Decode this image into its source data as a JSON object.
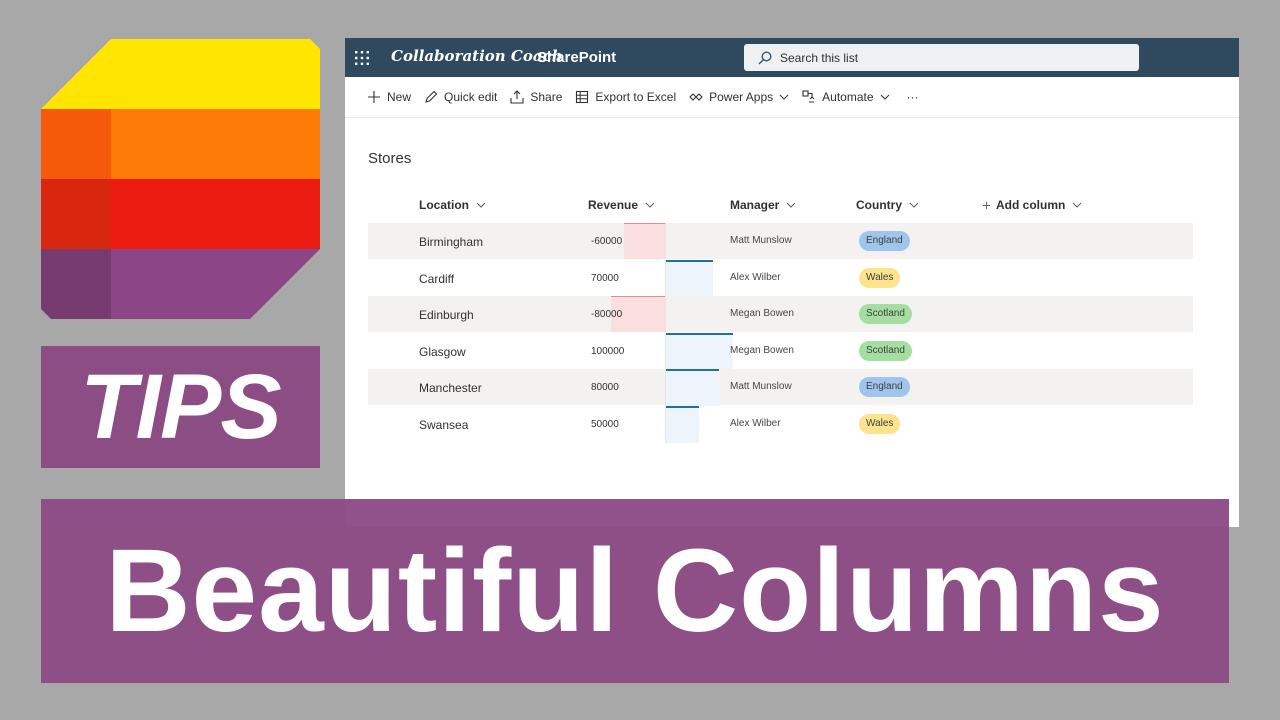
{
  "tips": {
    "label": "TIPS"
  },
  "banner": {
    "title": "Beautiful Columns"
  },
  "sharepoint": {
    "brand": "Collaboration Coach",
    "app_name": "SharePoint",
    "search_placeholder": "Search this list"
  },
  "toolbar": {
    "new": "New",
    "quick_edit": "Quick edit",
    "share": "Share",
    "export": "Export to Excel",
    "power_apps": "Power Apps",
    "automate": "Automate",
    "more": "···"
  },
  "list": {
    "title": "Stores",
    "columns": {
      "location": "Location",
      "revenue": "Revenue",
      "manager": "Manager",
      "country": "Country",
      "add": "Add column"
    },
    "rows": [
      {
        "location": "Birmingham",
        "revenue": "-60000",
        "revenue_value": -60000,
        "manager": "Matt Munslow",
        "country": "England"
      },
      {
        "location": "Cardiff",
        "revenue": "70000",
        "revenue_value": 70000,
        "manager": "Alex Wilber",
        "country": "Wales"
      },
      {
        "location": "Edinburgh",
        "revenue": "-80000",
        "revenue_value": -80000,
        "manager": "Megan Bowen",
        "country": "Scotland"
      },
      {
        "location": "Glasgow",
        "revenue": "100000",
        "revenue_value": 100000,
        "manager": "Megan Bowen",
        "country": "Scotland"
      },
      {
        "location": "Manchester",
        "revenue": "80000",
        "revenue_value": 80000,
        "manager": "Matt Munslow",
        "country": "England"
      },
      {
        "location": "Swansea",
        "revenue": "50000",
        "revenue_value": 50000,
        "manager": "Alex Wilber",
        "country": "Wales"
      }
    ]
  },
  "colors": {
    "england": "#9fc5ec",
    "wales": "#fde38b",
    "scotland": "#a4dea1",
    "banner": "#8c4c84",
    "topbar": "#2f4a5f"
  }
}
